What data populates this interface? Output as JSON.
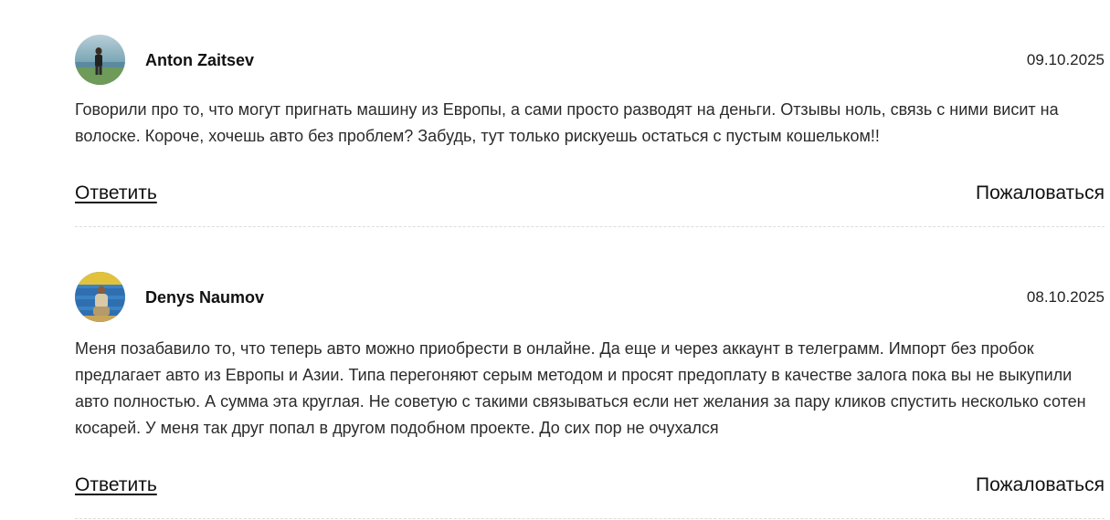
{
  "comments": [
    {
      "author": "Anton Zaitsev",
      "date": "09.10.2025",
      "text": "Говорили про то, что могут пригнать машину из Европы, а сами просто разводят на деньги. Отзывы ноль, связь с ними висит на волоске. Короче, хочешь авто без проблем? Забудь, тут только рискуешь остаться с пустым кошельком!!",
      "reply_label": "Ответить",
      "report_label": "Пожаловаться"
    },
    {
      "author": "Denys Naumov",
      "date": "08.10.2025",
      "text": "Меня позабавило то, что теперь авто можно приобрести в онлайне. Да еще и через аккаунт в телеграмм. Импорт без пробок предлагает авто из Европы и Азии. Типа перегоняют серым методом и просят предоплату в качестве залога пока вы не выкупили авто полностью. А сумма эта круглая. Не советую с такими связываться если нет желания за пару кликов спустить несколько сотен косарей. У меня так друг попал в другом подобном проекте. До сих пор не очухался",
      "reply_label": "Ответить",
      "report_label": "Пожаловаться"
    }
  ],
  "colors": {
    "text": "#2b2b2b",
    "heading": "#111111",
    "divider": "#dcdcdc"
  }
}
